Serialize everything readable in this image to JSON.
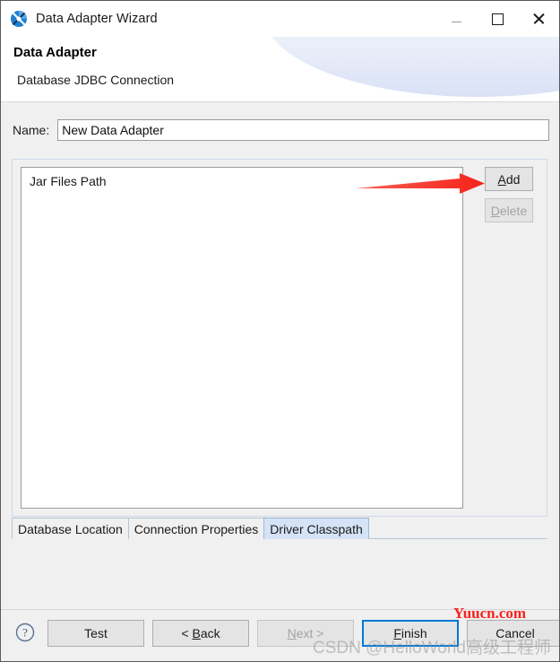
{
  "window": {
    "title": "Data Adapter Wizard",
    "icon": "data-adapter-icon",
    "controls": {
      "minimize": "minimize-icon",
      "maximize": "maximize-icon",
      "close": "close-icon"
    }
  },
  "header": {
    "title": "Data Adapter",
    "subtitle": "Database JDBC Connection"
  },
  "form": {
    "name_label": "Name:",
    "name_value": "New Data Adapter",
    "name_placeholder": ""
  },
  "classpath": {
    "list_header": "Jar Files Path",
    "items": [],
    "buttons": [
      {
        "label": "Add",
        "mnemonic": "A",
        "enabled": true
      },
      {
        "label": "Delete",
        "mnemonic": "D",
        "enabled": false
      }
    ]
  },
  "tabs": [
    {
      "label": "Database Location",
      "selected": false
    },
    {
      "label": "Connection Properties",
      "selected": false
    },
    {
      "label": "Driver Classpath",
      "selected": true
    }
  ],
  "footer": {
    "help_icon": "help-icon",
    "buttons": [
      {
        "label": "Test",
        "enabled": true,
        "focused": false
      },
      {
        "label": "< Back",
        "mnemonic": "B",
        "enabled": true,
        "focused": false
      },
      {
        "label": "Next >",
        "mnemonic": "N",
        "enabled": false,
        "focused": false
      },
      {
        "label": "Finish",
        "mnemonic": "F",
        "enabled": true,
        "focused": true
      },
      {
        "label": "Cancel",
        "enabled": true,
        "focused": false
      }
    ]
  },
  "annotations": {
    "arrow_color": "#f52a22",
    "arrow_target": "add-button"
  },
  "watermarks": {
    "top": "Yuucn.com",
    "top_color": "#fc2020",
    "bottom": "CSDN @HelloWorld高级工程师"
  }
}
